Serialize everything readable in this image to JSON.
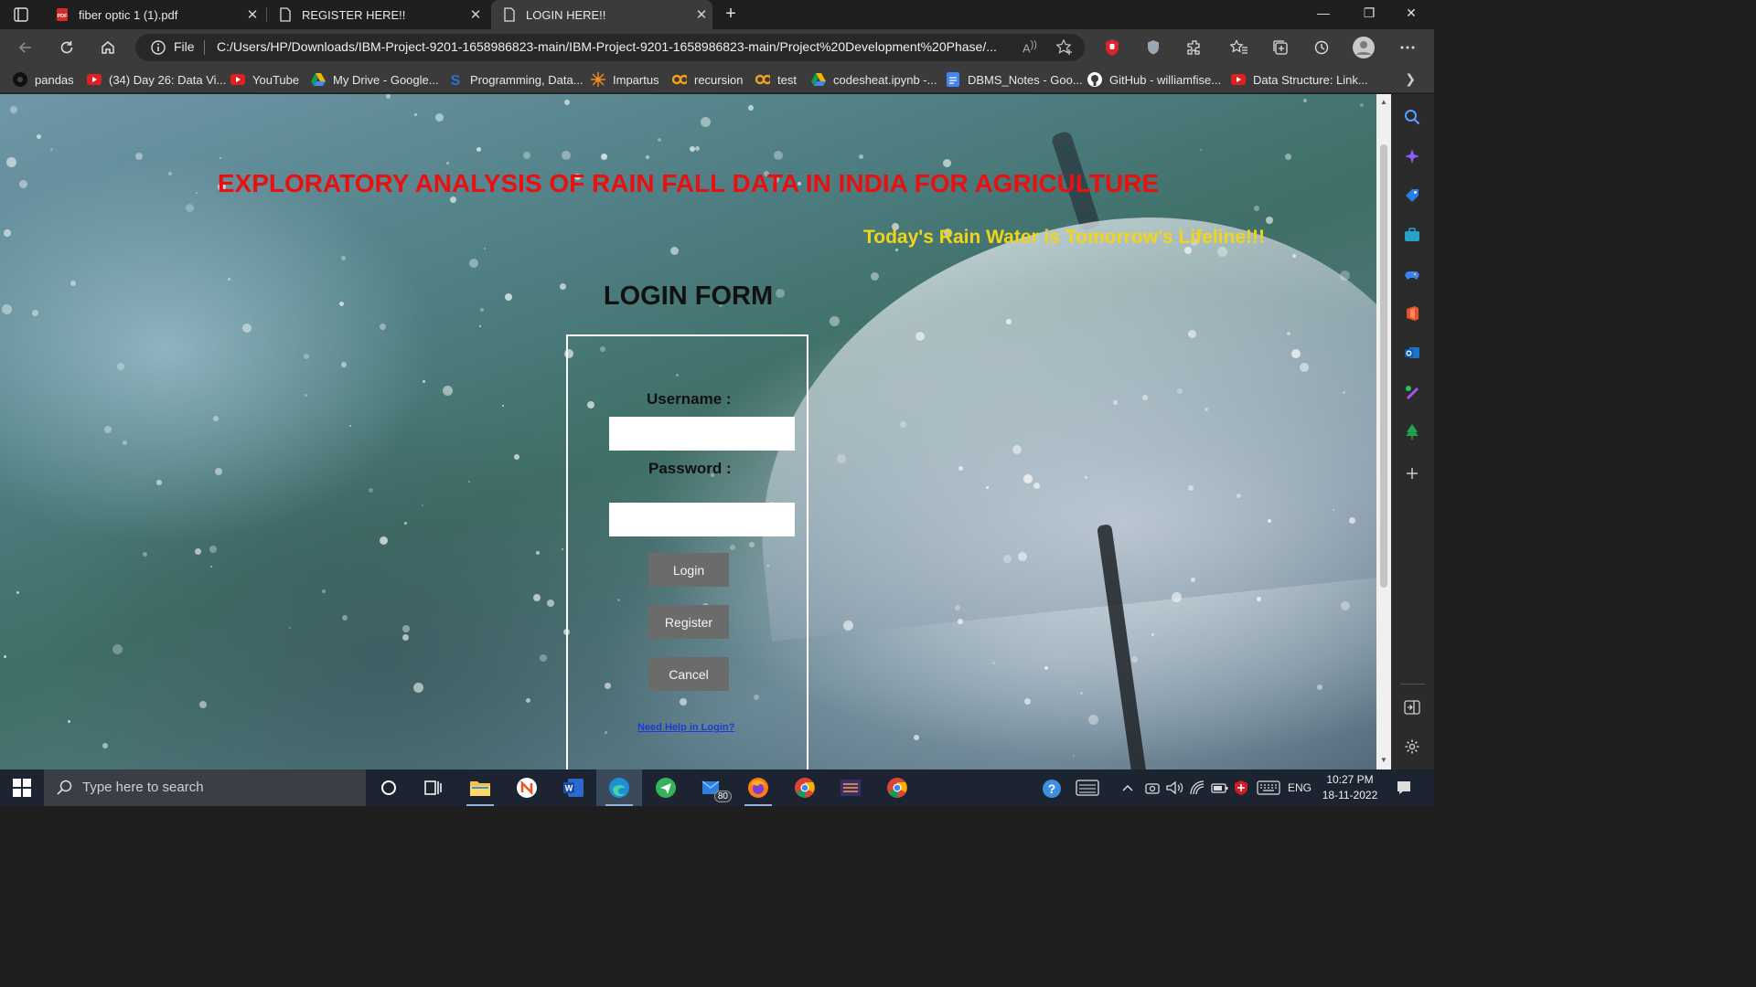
{
  "browser": {
    "tabs": [
      {
        "title": "fiber optic 1 (1).pdf",
        "icon": "pdf-icon"
      },
      {
        "title": "REGISTER HERE!!",
        "icon": "document-icon"
      },
      {
        "title": "LOGIN HERE!!",
        "icon": "document-icon",
        "active": true
      }
    ],
    "address": {
      "scheme_label": "File",
      "url": "C:/Users/HP/Downloads/IBM-Project-9201-1658986823-main/IBM-Project-9201-1658986823-main/Project%20Development%20Phase/..."
    },
    "bookmarks": [
      {
        "label": "pandas",
        "icon": "pandas-icon",
        "color": "#111111"
      },
      {
        "label": "(34) Day 26: Data Vi...",
        "icon": "youtube-icon",
        "color": "#e02020"
      },
      {
        "label": "YouTube",
        "icon": "youtube-icon",
        "color": "#e02020"
      },
      {
        "label": "My Drive - Google...",
        "icon": "google-drive-icon",
        "color": "#f4b400"
      },
      {
        "label": "Programming, Data...",
        "icon": "s-logo-icon",
        "color": "#2d6fd6"
      },
      {
        "label": "Impartus",
        "icon": "impartus-icon",
        "color": "#f08a1c"
      },
      {
        "label": "recursion",
        "icon": "colab-icon",
        "color": "#f2a21a"
      },
      {
        "label": "test",
        "icon": "colab-icon",
        "color": "#f2a21a"
      },
      {
        "label": "codesheat.ipynb -...",
        "icon": "google-drive-icon",
        "color": "#f4b400"
      },
      {
        "label": "DBMS_Notes - Goo...",
        "icon": "google-docs-icon",
        "color": "#4285f4"
      },
      {
        "label": "GitHub - williamfise...",
        "icon": "github-icon",
        "color": "#ffffff"
      },
      {
        "label": "Data Structure: Link...",
        "icon": "youtube-icon",
        "color": "#e02020"
      }
    ]
  },
  "page": {
    "title": "EXPLORATORY ANALYSIS OF RAIN FALL DATA IN INDIA FOR AGRICULTURE",
    "tagline": "Today's Rain Water is Tomorrow's Lifeline!!!",
    "form_heading": "LOGIN FORM",
    "form": {
      "username_label": "Username :",
      "username_value": "",
      "password_label": "Password :",
      "password_value": "",
      "login_label": "Login",
      "register_label": "Register",
      "cancel_label": "Cancel",
      "help_link": "Need Help in Login?"
    },
    "colors": {
      "title": "#e81010",
      "tagline": "#f2d51a",
      "button": "#6b6b6b"
    }
  },
  "taskbar": {
    "search_placeholder": "Type here to search",
    "mail_badge": "80",
    "language": "ENG",
    "time": "10:27 PM",
    "date": "18-11-2022"
  }
}
